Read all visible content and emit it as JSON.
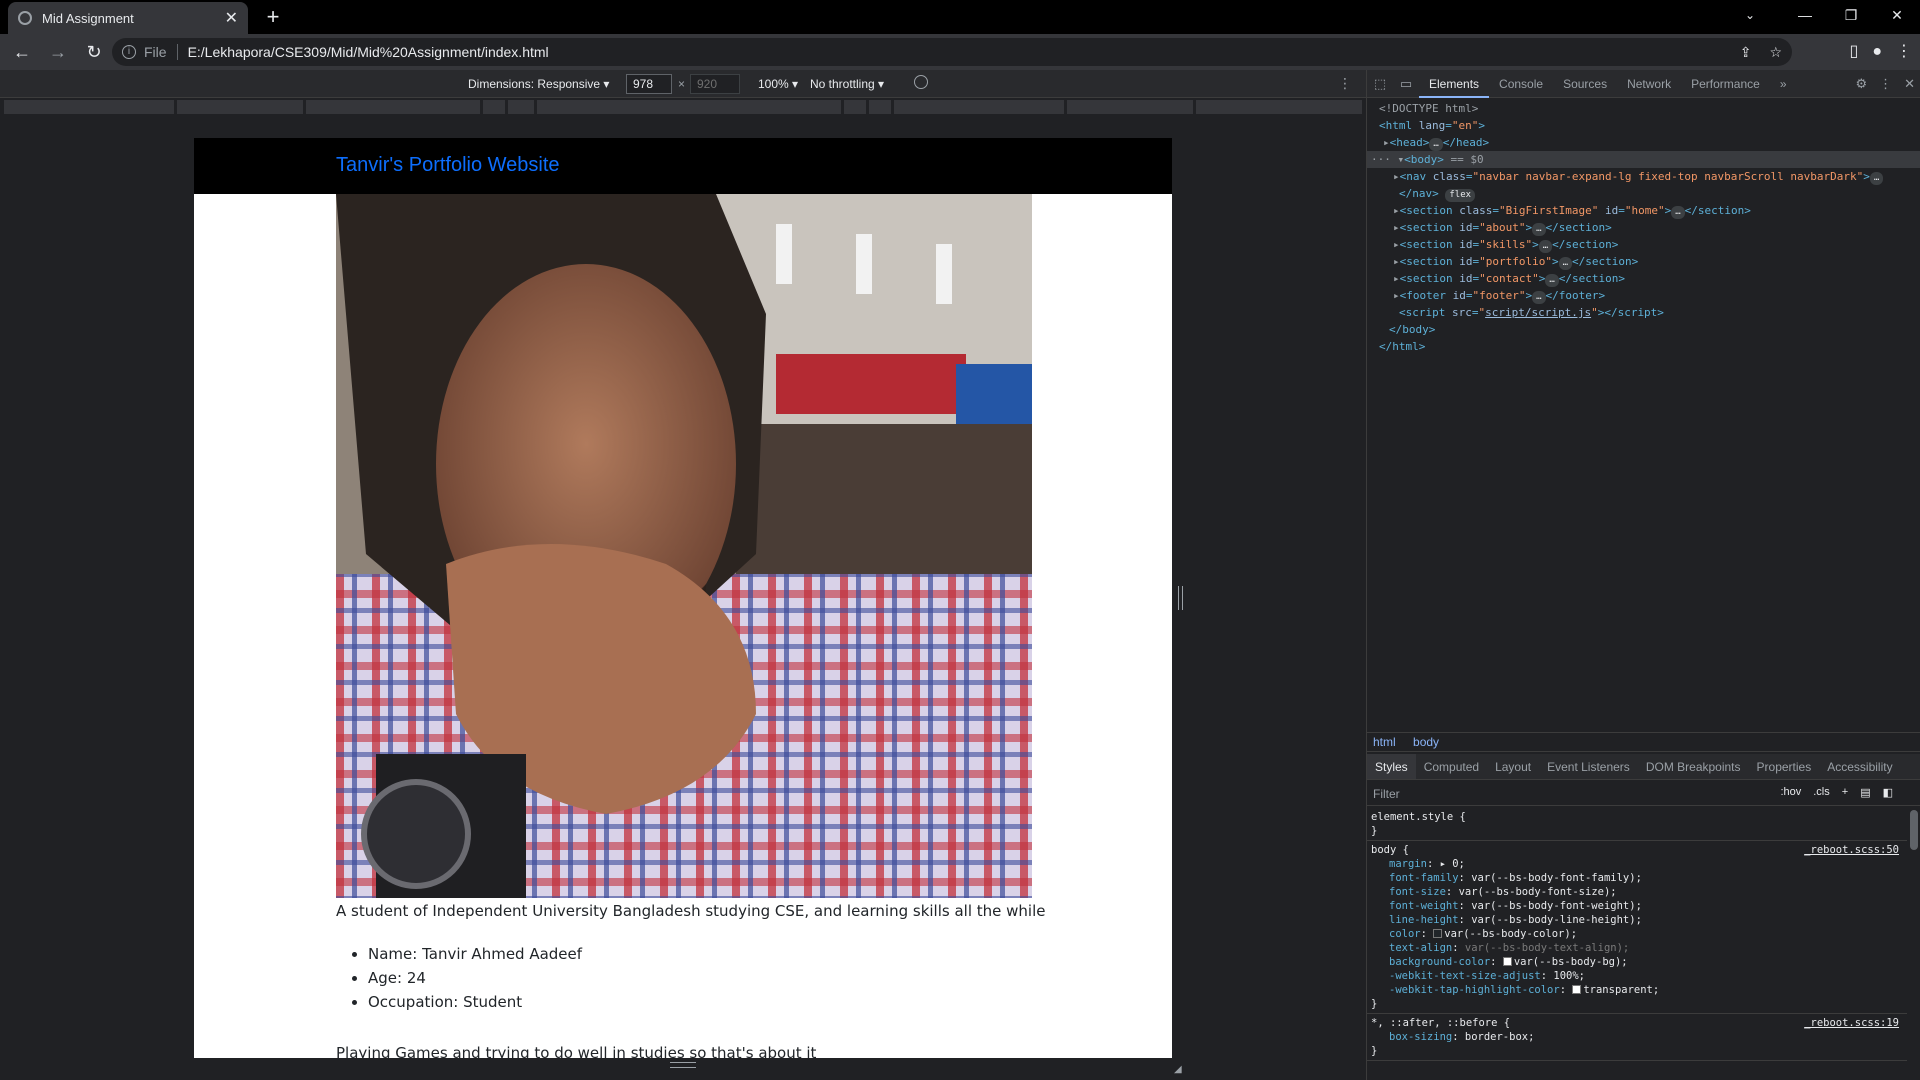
{
  "browser": {
    "tab_title": "Mid Assignment",
    "tab_close": "✕",
    "new_tab": "+",
    "scheme_label": "File",
    "url": "E:/Lekhapora/CSE309/Mid/Mid%20Assignment/index.html"
  },
  "device_toolbar": {
    "dimensions_label": "Dimensions: Responsive ▾",
    "width": "978",
    "times": "×",
    "height": "920",
    "zoom": "100% ▾",
    "throttling": "No throttling ▾"
  },
  "page": {
    "brand": "Tanvir's Portfolio Website",
    "about_text": "A student of Independent University Bangladesh studying CSE, and learning skills all the while",
    "details": [
      "Name: Tanvir Ahmed Aadeef",
      "Age: 24",
      "Occupation: Student"
    ],
    "hobby_text": "Playing Games and trying to do well in studies so that's about it"
  },
  "devtools": {
    "tabs": [
      "Elements",
      "Console",
      "Sources",
      "Network",
      "Performance",
      "»"
    ],
    "dom": {
      "doctype": "<!DOCTYPE html>",
      "html_open": "<html lang=\"en\">",
      "head": "<head>",
      "head_close": "</head>",
      "body_open": "<body>",
      "body_marker": " == $0",
      "nav_class": "navbar navbar-expand-lg fixed-top navbarScroll navbarDark",
      "nav_close": "</nav>",
      "flex_badge": "flex",
      "section_bigfirst_class": "BigFirstImage",
      "section_home_id": "home",
      "section_ids": [
        "about",
        "skills",
        "portfolio",
        "contact"
      ],
      "footer_id": "footer",
      "script_src": "script/script.js",
      "body_close": "</body>",
      "html_close": "</html>"
    },
    "breadcrumbs": [
      "html",
      "body"
    ],
    "style_tabs": [
      "Styles",
      "Computed",
      "Layout",
      "Event Listeners",
      "DOM Breakpoints",
      "Properties",
      "Accessibility"
    ],
    "filter_placeholder": "Filter",
    "filter_tools": [
      ":hov",
      ".cls",
      "+"
    ],
    "element_style": "element.style {",
    "body_rule": {
      "selector": "body {",
      "source": "_reboot.scss:50",
      "props": [
        {
          "name": "margin",
          "value": "▸ 0;"
        },
        {
          "name": "font-family",
          "value": "var(--bs-body-font-family);"
        },
        {
          "name": "font-size",
          "value": "var(--bs-body-font-size);"
        },
        {
          "name": "font-weight",
          "value": "var(--bs-body-font-weight);"
        },
        {
          "name": "line-height",
          "value": "var(--bs-body-line-height);"
        },
        {
          "name": "color",
          "value": "var(--bs-body-color);"
        },
        {
          "name": "text-align",
          "value": "var(--bs-body-text-align);"
        },
        {
          "name": "background-color",
          "value": "var(--bs-body-bg);"
        },
        {
          "name": "-webkit-text-size-adjust",
          "value": "100%;"
        },
        {
          "name": "-webkit-tap-highlight-color",
          "value": "transparent;"
        }
      ]
    },
    "universal_rule": {
      "selector": "*, ::after, ::before {",
      "source": "_reboot.scss:19",
      "props": [
        {
          "name": "box-sizing",
          "value": "border-box;"
        }
      ]
    }
  },
  "colors": {
    "brand_link": "#0d6efd",
    "navbar_bg": "#000000",
    "devtools_accent": "#8ab4f8"
  }
}
